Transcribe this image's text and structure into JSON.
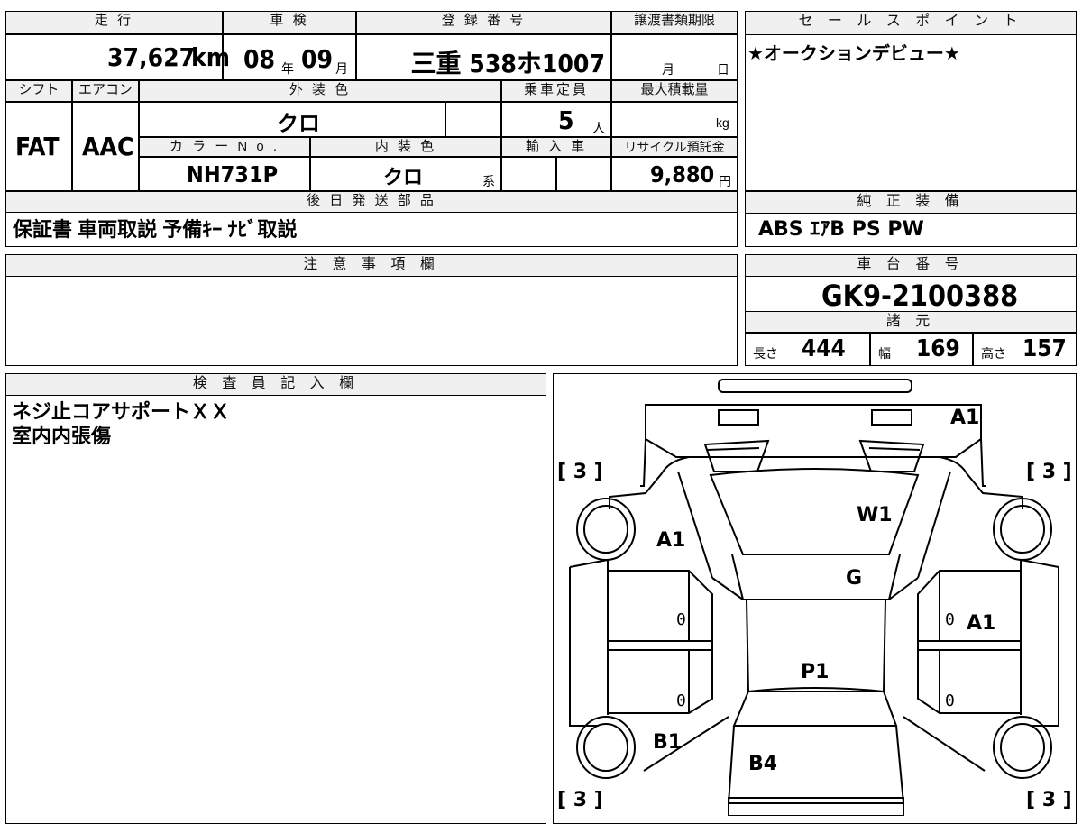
{
  "main_sheet": {
    "mileage": {
      "label": "走 行",
      "value": "37,627",
      "unit": "km"
    },
    "inspection": {
      "label": "車 検",
      "year": "08",
      "year_unit": "年",
      "month": "09",
      "month_unit": "月"
    },
    "registration": {
      "label": "登 録 番 号",
      "value": "三重 538ホ1007"
    },
    "transfer_deadline": {
      "label": "譲渡書類期限",
      "month_unit": "月",
      "day_unit": "日"
    },
    "shift": {
      "label": "シフト",
      "value": "FAT"
    },
    "aircon": {
      "label": "エアコン",
      "value": "AAC"
    },
    "exterior_color": {
      "label": "外 装 色",
      "value": "クロ"
    },
    "capacity": {
      "label": "乗車定員",
      "value": "5",
      "unit": "人"
    },
    "max_load": {
      "label": "最大積載量",
      "unit": "kg"
    },
    "color_no": {
      "label": "カ ラ ー N o .",
      "value": "NH731P"
    },
    "interior_color": {
      "label": "内 装 色",
      "value": "クロ",
      "suffix": "系"
    },
    "import": {
      "label": "輸 入 車"
    },
    "recycle": {
      "label": "リサイクル預託金",
      "value": "9,880",
      "unit": "円"
    },
    "later_parts": {
      "label": "後 日 発 送 部 品",
      "value": "保証書 車両取説 予備ｷｰ ﾅﾋﾞ取説"
    }
  },
  "sales_point": {
    "label": "セ ー ル ス ポ イ ン ト",
    "value": "★オークションデビュー★"
  },
  "genuine_equipment": {
    "label": "純 正 装 備",
    "value": "ABS ｴｱB PS PW"
  },
  "notes": {
    "label": "注 意 事 項 欄"
  },
  "chassis_number": {
    "label": "車 台 番 号",
    "value": "GK9-2100388"
  },
  "specs": {
    "label": "諸 元",
    "length_label": "長さ",
    "length": "444",
    "width_label": "幅",
    "width": "169",
    "height_label": "高さ",
    "height": "157"
  },
  "inspector": {
    "label": "検 査 員 記 入 欄",
    "lines": [
      "ネジ止コアサポートＸＸ",
      "室内内張傷"
    ]
  },
  "diagram": {
    "marks": {
      "front_bumper": "A1",
      "windshield": "W1",
      "left_front_fender": "A1",
      "hood_area": "G",
      "right_front_door": "A1",
      "roof": "P1",
      "left_rear": "B1",
      "rear": "B4"
    },
    "tire_grades": [
      "[ 3 ]",
      "[ 3 ]",
      "[ 3 ]",
      "[ 3 ]"
    ],
    "zeros": [
      "0",
      "0",
      "0",
      "0"
    ]
  }
}
